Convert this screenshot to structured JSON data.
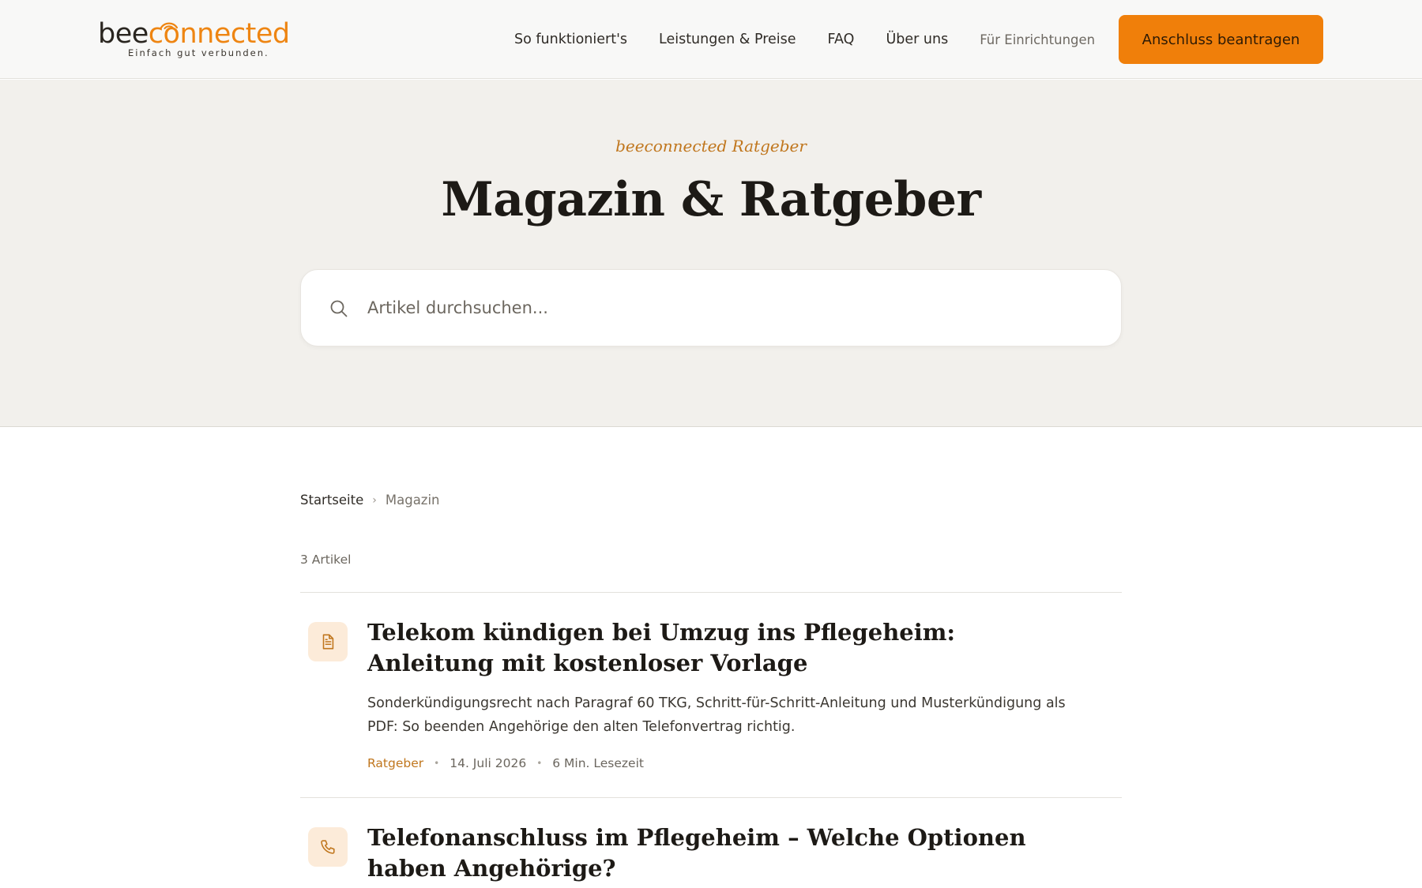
{
  "header": {
    "logo": {
      "word_a": "bee",
      "word_b": "connected",
      "tagline": "Einfach gut verbunden."
    },
    "nav": [
      {
        "label": "So funktioniert's"
      },
      {
        "label": "Leistungen & Preise"
      },
      {
        "label": "FAQ"
      },
      {
        "label": "Über uns"
      },
      {
        "label": "Für Einrichtungen"
      }
    ],
    "cta_label": "Anschluss beantragen"
  },
  "hero": {
    "eyebrow": "beeconnected Ratgeber",
    "title": "Magazin & Ratgeber",
    "search": {
      "placeholder": "Artikel durchsuchen...",
      "value": "",
      "icon": "search-icon"
    }
  },
  "breadcrumb": {
    "home": "Startseite",
    "separator": "›",
    "current": "Magazin"
  },
  "article_count": "3 Artikel",
  "articles": [
    {
      "icon": "document-icon",
      "title": "Telekom kündigen bei Umzug ins Pflegeheim: Anleitung mit kostenloser Vorlage",
      "excerpt": "Sonderkündigungsrecht nach Paragraf 60 TKG, Schritt-für-Schritt-Anleitung und Musterkündigung als PDF: So beenden Angehörige den alten Telefonvertrag richtig.",
      "category": "Ratgeber",
      "date": "14. Juli 2026",
      "read_time": "6 Min. Lesezeit"
    },
    {
      "icon": "phone-icon",
      "title": "Telefonanschluss im Pflegeheim – Welche Optionen haben Angehörige?"
    }
  ],
  "colors": {
    "accent": "#f07f0a",
    "accent_text": "#c0761d",
    "hero_bg": "#f2f0ec",
    "icon_bg": "#fcebd9"
  }
}
